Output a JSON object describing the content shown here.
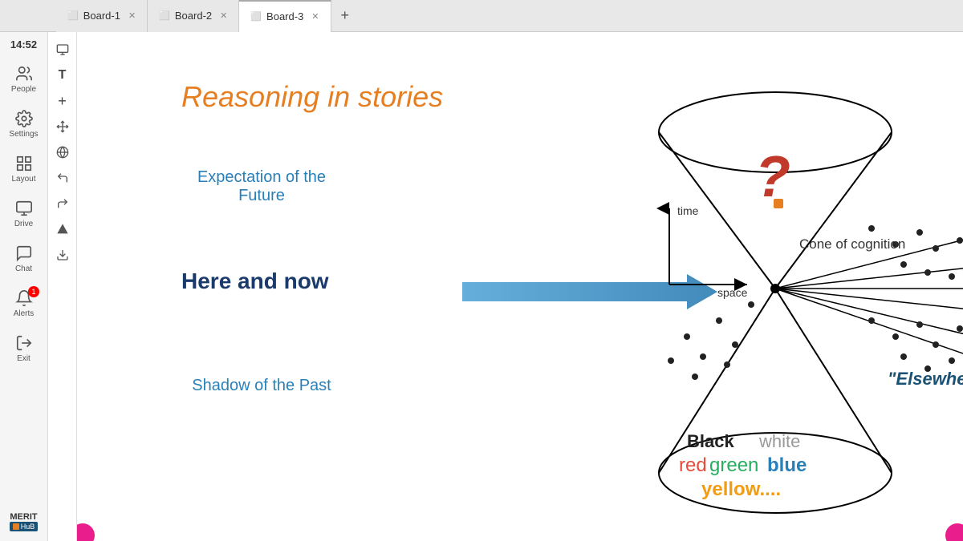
{
  "time": "14:52",
  "tabs": [
    {
      "id": "board1",
      "label": "Board-1",
      "active": false
    },
    {
      "id": "board2",
      "label": "Board-2",
      "active": false
    },
    {
      "id": "board3",
      "label": "Board-3",
      "active": true
    }
  ],
  "sidebar": {
    "items": [
      {
        "id": "people",
        "label": "People",
        "icon": "👤"
      },
      {
        "id": "settings",
        "label": "Settings",
        "icon": "⚙"
      },
      {
        "id": "layout",
        "label": "Layout",
        "icon": "▦"
      },
      {
        "id": "drive",
        "label": "Drive",
        "icon": "🗂"
      },
      {
        "id": "chat",
        "label": "Chat",
        "icon": "💬"
      },
      {
        "id": "alerts",
        "label": "Alerts",
        "icon": "🔔",
        "badge": "1"
      },
      {
        "id": "exit",
        "label": "Exit",
        "icon": "➜"
      }
    ],
    "brand": {
      "name": "MERIT",
      "sub": "HuB"
    }
  },
  "tools": [
    "⬜",
    "T",
    "+",
    "✛",
    "🌐",
    "↩",
    "↪",
    "◆",
    "⬇"
  ],
  "canvas": {
    "title": "Reasoning in stories",
    "expectation": "Expectation of the Future",
    "here_now": "Here and now",
    "shadow": "Shadow of the Past",
    "elsewhere": "\"Elsewhere\"",
    "cone_label": "Cone of cognition",
    "time_label": "time",
    "space_label": "space",
    "colors_line1_black": "Black",
    "colors_line1_white": "white",
    "colors_line2_red": "red",
    "colors_line2_green": "green",
    "colors_line2_blue": "blue",
    "colors_line3_yellow": "yellow...."
  }
}
